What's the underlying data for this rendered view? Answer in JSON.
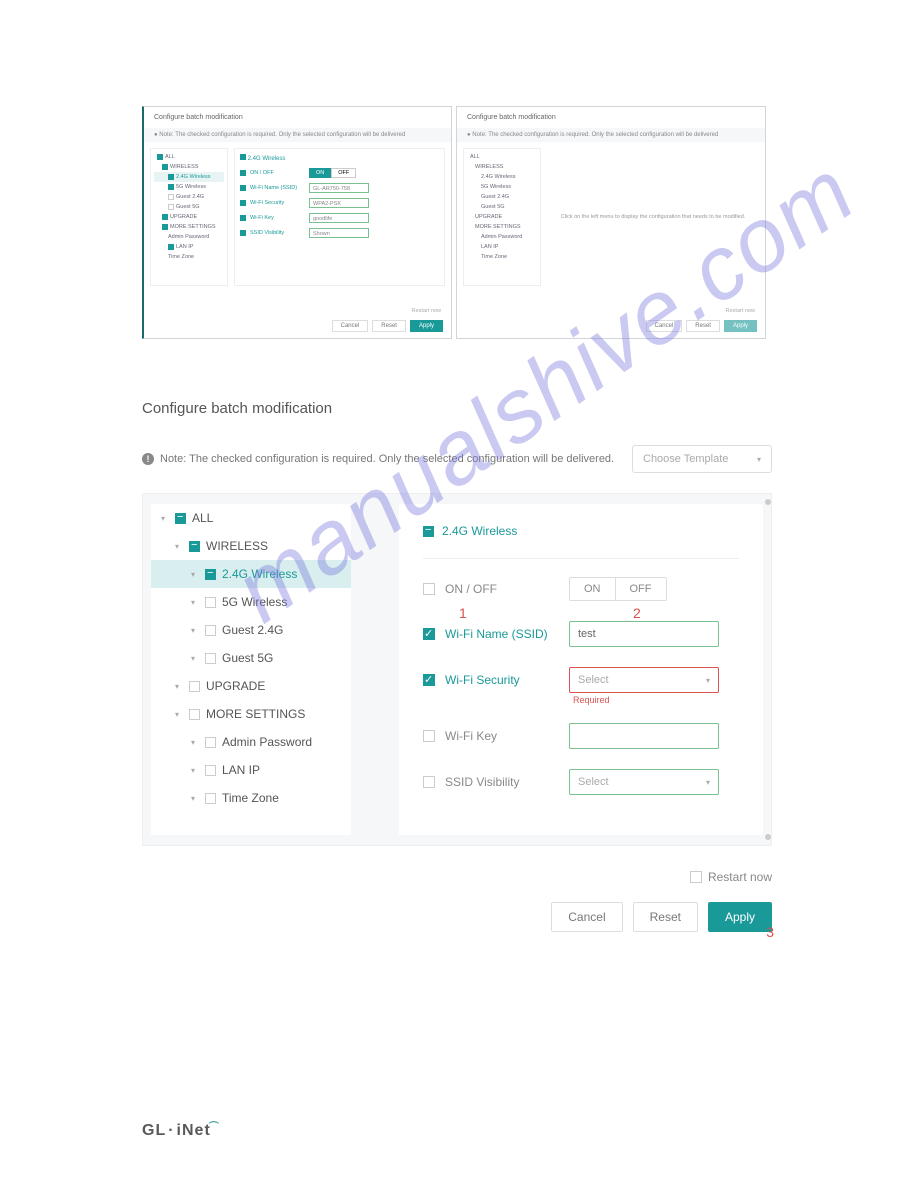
{
  "watermark": "manualshive.com",
  "small_left": {
    "title": "Configure batch modification",
    "note": "● Note: The checked configuration is required. Only the selected configuration will be delivered",
    "tree": {
      "all": "ALL",
      "wireless": "WIRELESS",
      "w24": "2.4G Wireless",
      "w5": "5G Wireless",
      "g24": "Guest 2.4G",
      "g5": "Guest 5G",
      "upgrade": "UPGRADE",
      "more": "MORE SETTINGS",
      "admin": "Admin Password",
      "lan": "LAN IP",
      "tz": "Time Zone"
    },
    "form": {
      "title": "2.4G Wireless",
      "onoff": "ON / OFF",
      "on": "ON",
      "off": "OFF",
      "ssid_label": "Wi-Fi Name (SSID)",
      "ssid_val": "GL-AR750-758",
      "sec_label": "Wi-Fi Security",
      "sec_val": "WPA2-PSK",
      "key_label": "Wi-Fi Key",
      "key_val": "goodlife",
      "vis_label": "SSID Visibility",
      "vis_val": "Shown"
    },
    "restart": "Restart now",
    "cancel": "Cancel",
    "reset": "Reset",
    "apply": "Apply"
  },
  "small_right": {
    "title": "Configure batch modification",
    "note": "● Note: The checked configuration is required. Only the selected configuration will be delivered",
    "placeholder": "Click on the left menu to display the configuration that needs to be modified.",
    "restart": "Restart now",
    "cancel": "Cancel",
    "reset": "Reset",
    "apply": "Apply"
  },
  "main": {
    "title": "Configure batch modification",
    "note": "Note: The checked configuration is required. Only the selected configuration will be delivered.",
    "template_placeholder": "Choose Template",
    "tree": {
      "all": "ALL",
      "wireless": "WIRELESS",
      "w24": "2.4G Wireless",
      "w5": "5G Wireless",
      "g24": "Guest 2.4G",
      "g5": "Guest 5G",
      "upgrade": "UPGRADE",
      "more": "MORE SETTINGS",
      "admin": "Admin Password",
      "lan": "LAN IP",
      "tz": "Time Zone"
    },
    "form": {
      "title": "2.4G Wireless",
      "onoff_label": "ON / OFF",
      "on": "ON",
      "off": "OFF",
      "ssid_label": "Wi-Fi Name (SSID)",
      "ssid_value": "test",
      "sec_label": "Wi-Fi Security",
      "sec_placeholder": "Select",
      "sec_required": "Required",
      "key_label": "Wi-Fi Key",
      "key_value": "",
      "vis_label": "SSID Visibility",
      "vis_placeholder": "Select"
    },
    "annot1": "1",
    "annot2": "2",
    "annot3": "3",
    "restart": "Restart now",
    "cancel": "Cancel",
    "reset": "Reset",
    "apply": "Apply"
  },
  "logo": {
    "gl": "GL",
    "inet": "iNet"
  }
}
